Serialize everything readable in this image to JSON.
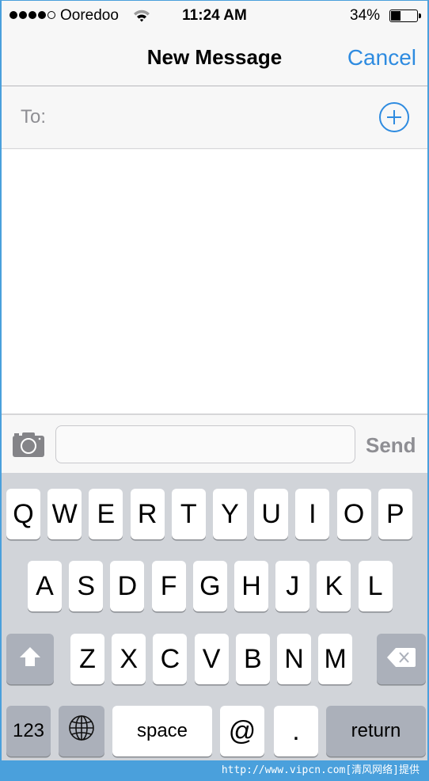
{
  "status_bar": {
    "signal_bars_filled": 4,
    "signal_bars_total": 5,
    "carrier": "Ooredoo",
    "wifi_icon": "wifi-icon",
    "time": "11:24 AM",
    "battery_percent_label": "34%",
    "battery_level": 0.34
  },
  "nav": {
    "title": "New Message",
    "cancel_label": "Cancel"
  },
  "recipient": {
    "label": "To:",
    "value": "",
    "add_icon": "plus-circle-icon"
  },
  "compose": {
    "camera_icon": "camera-icon",
    "message_value": "",
    "send_label": "Send"
  },
  "keyboard": {
    "row1": [
      "Q",
      "W",
      "E",
      "R",
      "T",
      "Y",
      "U",
      "I",
      "O",
      "P"
    ],
    "row2": [
      "A",
      "S",
      "D",
      "F",
      "G",
      "H",
      "J",
      "K",
      "L"
    ],
    "row3": [
      "Z",
      "X",
      "C",
      "V",
      "B",
      "N",
      "M"
    ],
    "shift_icon": "shift-arrow-icon",
    "delete_icon": "backspace-icon",
    "numbers_label": "123",
    "globe_icon": "globe-icon",
    "space_label": "space",
    "at_label": "@",
    "dot_label": ".",
    "return_label": "return"
  },
  "watermark": "http://www.vipcn.com[清风网络]提供",
  "colors": {
    "accent": "#2e8be0",
    "keyboard_bg": "#d1d4d9",
    "dark_key": "#abb0ba",
    "send_disabled": "#8e8e93"
  }
}
